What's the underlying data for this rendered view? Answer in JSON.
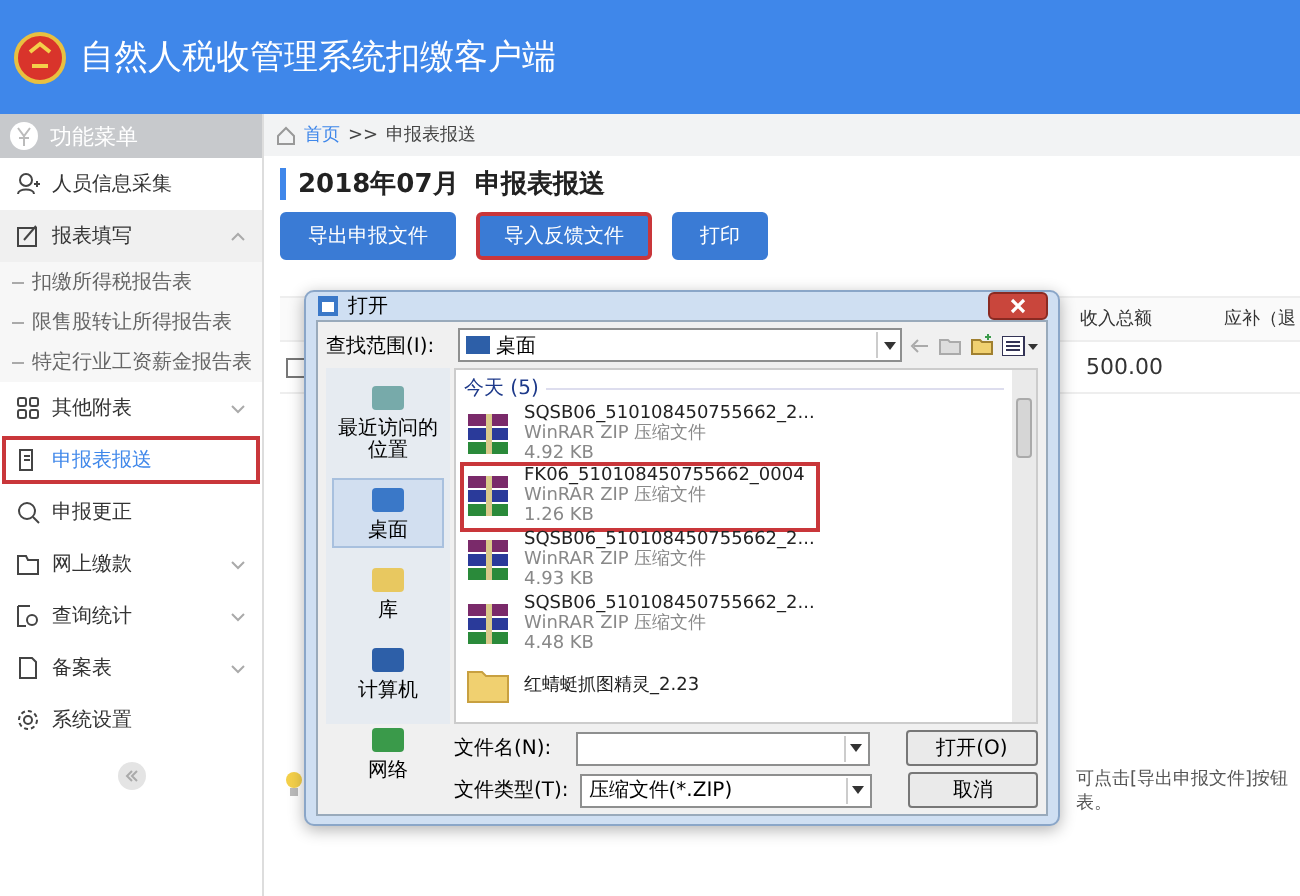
{
  "app": {
    "title": "自然人税收管理系统扣缴客户端"
  },
  "sidebar": {
    "title": "功能菜单",
    "items": [
      {
        "kind": "link",
        "label": "人员信息采集",
        "selected": false,
        "highlighted": false
      },
      {
        "kind": "group",
        "label": "报表填写",
        "expanded": true,
        "children": [
          {
            "label": "扣缴所得税报告表"
          },
          {
            "label": "限售股转让所得报告表"
          },
          {
            "label": "特定行业工资薪金报告表"
          }
        ]
      },
      {
        "kind": "group",
        "label": "其他附表",
        "expanded": false
      },
      {
        "kind": "link",
        "label": "申报表报送",
        "selected": true,
        "highlighted": true
      },
      {
        "kind": "link",
        "label": "申报更正",
        "selected": false,
        "highlighted": false
      },
      {
        "kind": "group",
        "label": "网上缴款",
        "expanded": false
      },
      {
        "kind": "group",
        "label": "查询统计",
        "expanded": false
      },
      {
        "kind": "group",
        "label": "备案表",
        "expanded": false
      },
      {
        "kind": "link",
        "label": "系统设置",
        "selected": false,
        "highlighted": false
      }
    ]
  },
  "breadcrumb": {
    "home": "首页",
    "separator": ">>",
    "current": "申报表报送"
  },
  "page": {
    "period": "2018年07月",
    "title": "申报表报送"
  },
  "buttons": [
    {
      "label": "导出申报文件",
      "highlighted": false
    },
    {
      "label": "导入反馈文件",
      "highlighted": true
    },
    {
      "label": "打印",
      "highlighted": false
    }
  ],
  "table": {
    "columns": [
      "收入总额",
      "应补（退"
    ],
    "rows": [
      {
        "checked": false,
        "cells": [
          "500.00"
        ]
      }
    ]
  },
  "notice": {
    "lines": [
      "可点击[导出申报文件]按钮",
      "表。"
    ]
  },
  "dialog": {
    "title": "打开",
    "look_in": {
      "label": "查找范围(I):",
      "value": "桌面"
    },
    "places": [
      {
        "label": "最近访问的位置",
        "selected": false
      },
      {
        "label": "桌面",
        "selected": true
      },
      {
        "label": "库",
        "selected": false
      },
      {
        "label": "计算机",
        "selected": false
      },
      {
        "label": "网络",
        "selected": false
      }
    ],
    "group": "今天 (5)",
    "files": [
      {
        "kind": "archive",
        "name": "SQSB06_510108450755662_2...",
        "type": "WinRAR ZIP 压缩文件",
        "size": "4.92 KB",
        "highlighted": false
      },
      {
        "kind": "archive",
        "name": "FK06_510108450755662_0004",
        "type": "WinRAR ZIP 压缩文件",
        "size": "1.26 KB",
        "highlighted": true
      },
      {
        "kind": "archive",
        "name": "SQSB06_510108450755662_2...",
        "type": "WinRAR ZIP 压缩文件",
        "size": "4.93 KB",
        "highlighted": false
      },
      {
        "kind": "archive",
        "name": "SQSB06_510108450755662_2...",
        "type": "WinRAR ZIP 压缩文件",
        "size": "4.48 KB",
        "highlighted": false
      },
      {
        "kind": "folder",
        "name": "红蜻蜓抓图精灵_2.23",
        "highlighted": false
      }
    ],
    "file_name": {
      "label": "文件名(N):"
    },
    "file_type": {
      "label": "文件类型(T):",
      "value": "压缩文件(*.ZIP)"
    },
    "buttons": [
      "打开(O)",
      "取消"
    ]
  }
}
